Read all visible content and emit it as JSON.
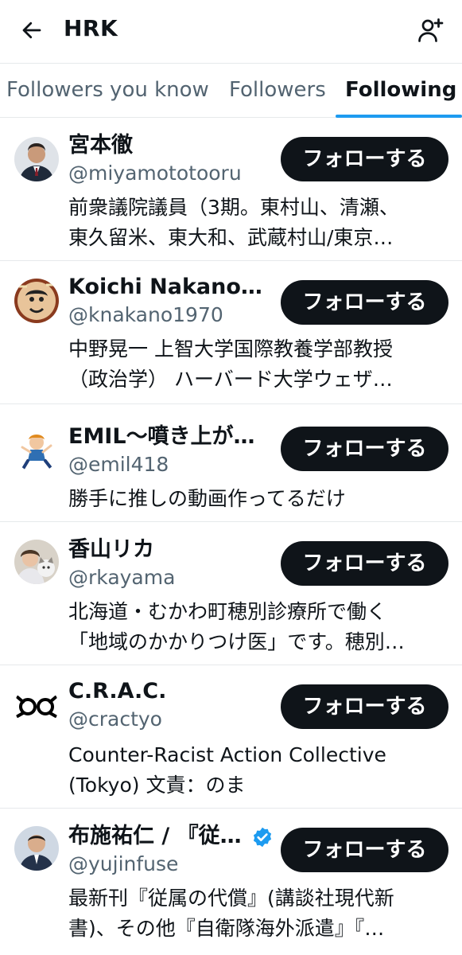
{
  "header": {
    "title": "HRK",
    "back_icon": "back-arrow-icon",
    "add_user_icon": "add-user-icon"
  },
  "tabs": [
    {
      "label": "Followers you know",
      "active": false
    },
    {
      "label": "Followers",
      "active": false
    },
    {
      "label": "Following",
      "active": true
    }
  ],
  "colors": {
    "accent": "#1d9bf0",
    "text": "#0f1419",
    "secondary_text": "#536471",
    "button_bg": "#0f1419",
    "button_text": "#ffffff",
    "divider": "#e6e9eb"
  },
  "follow_label": "フォローする",
  "users": [
    {
      "name": "宮本徹",
      "handle": "@miyamototooru",
      "bio": [
        "前衆議院議員（3期。東村山、清瀬、",
        "東久留米、東大和、武蔵村山/東京…"
      ],
      "verified": false
    },
    {
      "name": "Koichi Nakano@…",
      "handle": "@knakano1970",
      "bio": [
        "中野晃一 上智大学国際教養学部教授",
        "（政治学） ハーバード大学ウェザ…"
      ],
      "verified": false
    },
    {
      "name": "EMIL～噴き上が…",
      "handle": "@emil418",
      "bio": [
        "勝手に推しの動画作ってるだけ"
      ],
      "verified": false
    },
    {
      "name": "香山リカ",
      "handle": "@rkayama",
      "bio": [
        "北海道・むかわ町穂別診療所で働く",
        "「地域のかかりつけ医」です。穂別…"
      ],
      "verified": false
    },
    {
      "name": "C.R.A.C.",
      "handle": "@cractyo",
      "bio": [
        "Counter-Racist Action Collective",
        "(Tokyo) 文責：のま"
      ],
      "verified": false
    },
    {
      "name": "布施祐仁 / 『従…",
      "handle": "@yujinfuse",
      "bio": [
        "最新刊『従属の代償』(講談社現代新",
        "書)、その他『自衛隊海外派遣』『…"
      ],
      "verified": true
    }
  ]
}
